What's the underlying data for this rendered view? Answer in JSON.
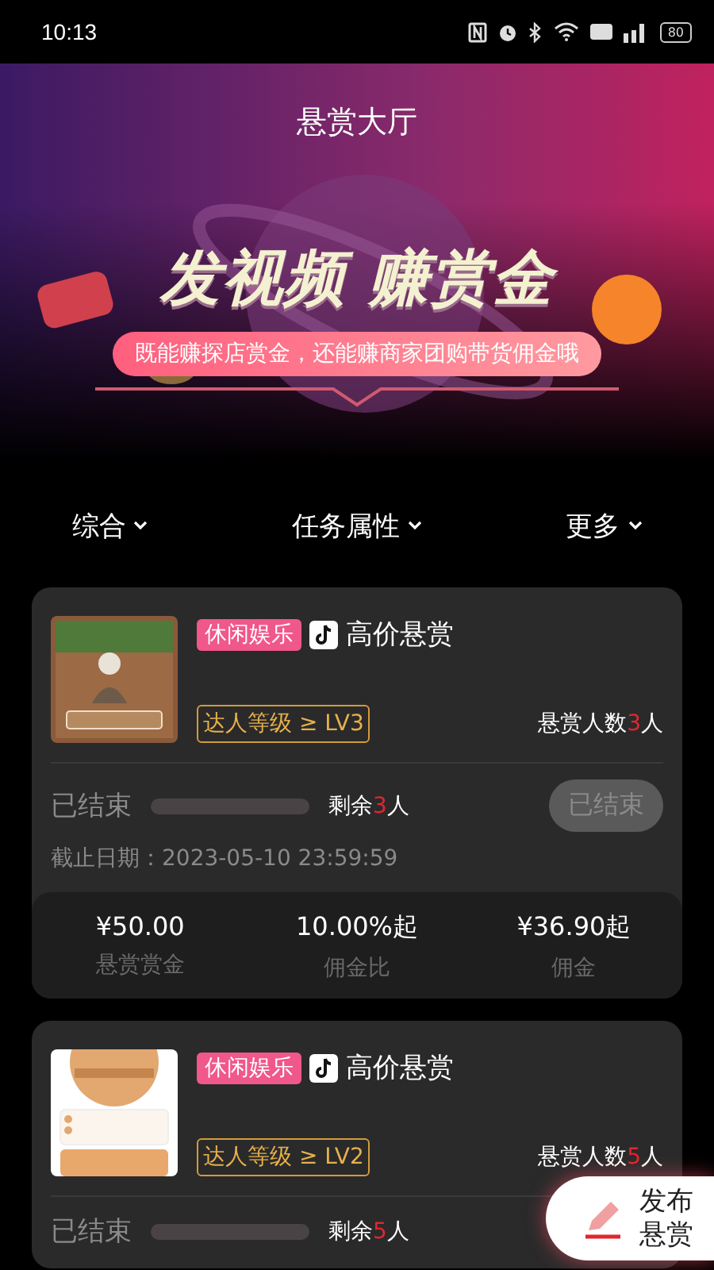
{
  "status_bar": {
    "time": "10:13",
    "battery": "80"
  },
  "header": {
    "title": "悬赏大厅",
    "headline": "发视频 赚赏金",
    "subline": "既能赚探店赏金，还能赚商家团购带货佣金哦"
  },
  "filters": [
    {
      "label": "综合"
    },
    {
      "label": "任务属性"
    },
    {
      "label": "更多"
    }
  ],
  "cards": [
    {
      "category": "休闲娱乐",
      "title": "高价悬赏",
      "level_req": "达人等级 ≥ LV3",
      "headcount": {
        "label": "悬赏人数",
        "count": "3",
        "unit": "人"
      },
      "status": "已结束",
      "progress": {
        "level": 0
      },
      "remaining": {
        "label": "剩余",
        "count": "3",
        "unit": "人"
      },
      "button": {
        "label": "已结束",
        "disabled": true
      },
      "deadline": "截止日期：2023-05-10 23:59:59",
      "stats": [
        {
          "value": "¥50.00",
          "label": "悬赏赏金"
        },
        {
          "value": "10.00%起",
          "label": "佣金比"
        },
        {
          "value": "¥36.90起",
          "label": "佣金"
        }
      ]
    },
    {
      "category": "休闲娱乐",
      "title": "高价悬赏",
      "level_req": "达人等级 ≥ LV2",
      "headcount": {
        "label": "悬赏人数",
        "count": "5",
        "unit": "人"
      },
      "status": "已结束",
      "progress": {
        "level": 0
      },
      "remaining": {
        "label": "剩余",
        "count": "5",
        "unit": "人"
      }
    }
  ],
  "fab": {
    "label": "发布悬赏"
  }
}
